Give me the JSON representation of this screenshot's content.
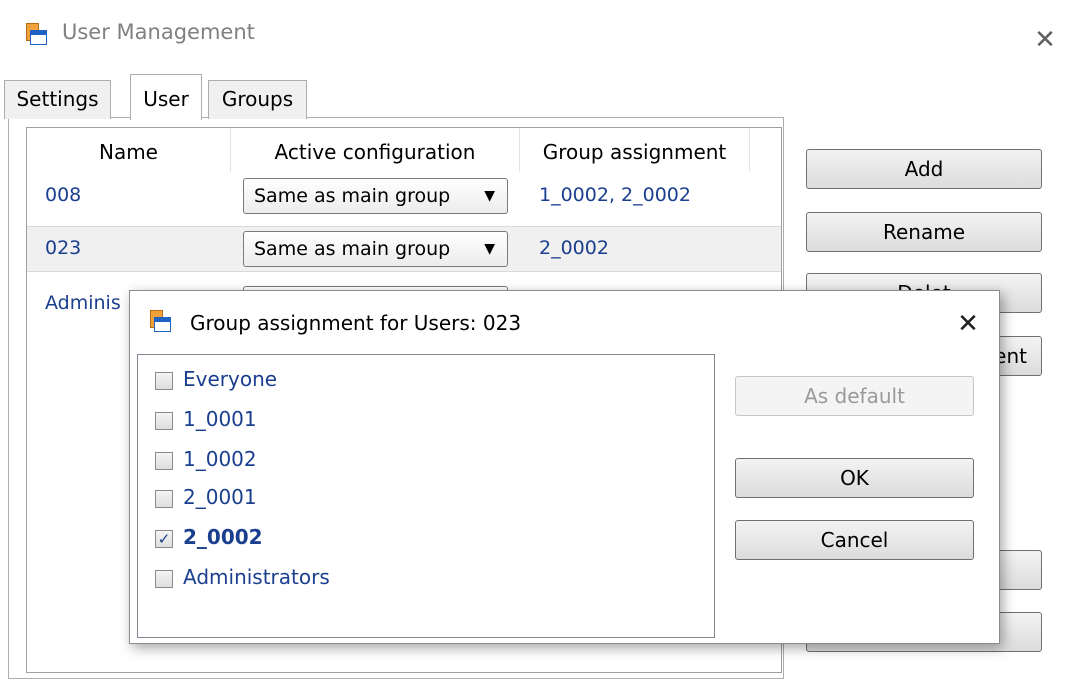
{
  "window": {
    "title": "User Management",
    "close_symbol": "✕"
  },
  "tabs": [
    {
      "label": "Settings"
    },
    {
      "label": "User"
    },
    {
      "label": "Groups"
    }
  ],
  "grid": {
    "columns": [
      "Name",
      "Active configuration",
      "Group assignment"
    ],
    "rows": [
      {
        "name": "008",
        "config": "Same as main group",
        "groups": "1_0002, 2_0002"
      },
      {
        "name": "023",
        "config": "Same as main group",
        "groups": "2_0002"
      },
      {
        "name": "Adminis"
      }
    ],
    "dropdown_arrow": "▼"
  },
  "side_buttons": [
    "Add",
    "Rename",
    "Delet",
    "ent"
  ],
  "dialog": {
    "title": "Group assignment for Users: 023",
    "close_symbol": "✕",
    "groups": [
      {
        "label": "Everyone",
        "checked": false
      },
      {
        "label": "1_0001",
        "checked": false
      },
      {
        "label": "1_0002",
        "checked": false
      },
      {
        "label": "2_0001",
        "checked": false
      },
      {
        "label": "2_0002",
        "checked": true
      },
      {
        "label": "Administrators",
        "checked": false
      }
    ],
    "check_mark": "✓",
    "buttons": {
      "as_default": "As default",
      "ok": "OK",
      "cancel": "Cancel"
    }
  }
}
